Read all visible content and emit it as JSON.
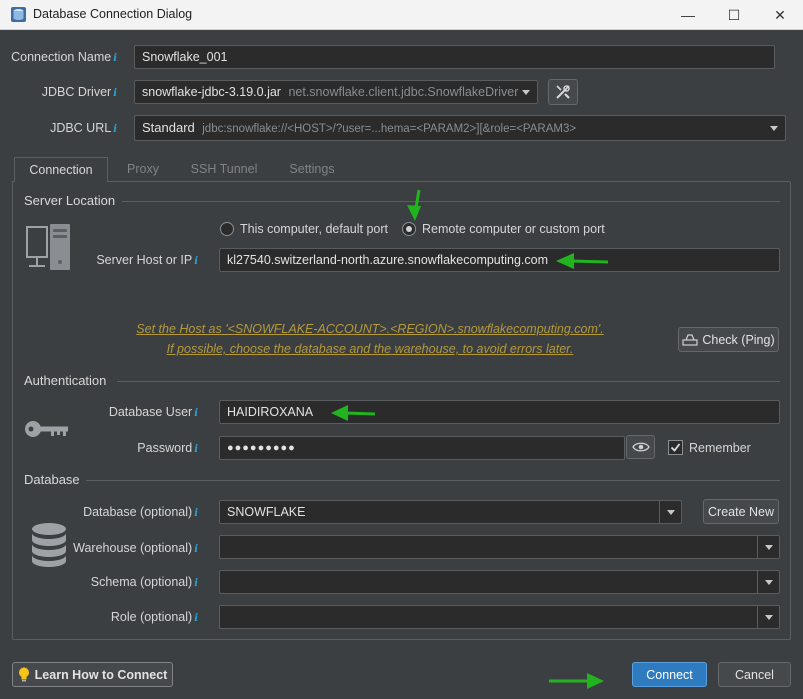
{
  "window": {
    "title": "Database Connection Dialog",
    "minimize": "—",
    "maximize": "☐",
    "close": "✕"
  },
  "form": {
    "connection_name_label": "Connection Name",
    "connection_name_value": "Snowflake_001",
    "jdbc_driver_label": "JDBC Driver",
    "jdbc_driver_jar": "snowflake-jdbc-3.19.0.jar",
    "jdbc_driver_class": "net.snowflake.client.jdbc.SnowflakeDriver",
    "jdbc_url_label": "JDBC URL",
    "jdbc_url_mode": "Standard",
    "jdbc_url_template": "jdbc:snowflake://<HOST>/?user=...hema=<PARAM2>][&role=<PARAM3>"
  },
  "tabs": [
    {
      "label": "Connection",
      "active": true
    },
    {
      "label": "Proxy",
      "active": false
    },
    {
      "label": "SSH Tunnel",
      "active": false
    },
    {
      "label": "Settings",
      "active": false
    }
  ],
  "server": {
    "section_label": "Server Location",
    "radio_local_label": "This computer, default port",
    "radio_remote_label": "Remote computer or custom port",
    "selected": "remote",
    "host_label": "Server Host or IP",
    "host_value": "kl27540.switzerland-north.azure.snowflakecomputing.com",
    "hint_line1": "Set the Host as '<SNOWFLAKE-ACCOUNT>.<REGION>.snowflakecomputing.com'.",
    "hint_line2": "If possible, choose the database and the warehouse, to avoid errors later.",
    "ping_button": "Check (Ping)"
  },
  "auth": {
    "section_label": "Authentication",
    "user_label": "Database User",
    "user_value": "HAIDIROXANA",
    "password_label": "Password",
    "password_value": "●●●●●●●●●",
    "remember_label": "Remember",
    "remember_checked": true
  },
  "database": {
    "section_label": "Database",
    "database_label": "Database (optional)",
    "database_value": "SNOWFLAKE",
    "create_new_button": "Create New",
    "warehouse_label": "Warehouse (optional)",
    "warehouse_value": "",
    "schema_label": "Schema (optional)",
    "schema_value": "",
    "role_label": "Role (optional)",
    "role_value": ""
  },
  "footer": {
    "learn_button": "Learn How to Connect",
    "connect_button": "Connect",
    "cancel_button": "Cancel"
  },
  "colors": {
    "background": "#3c3f41",
    "field": "#2b2b2b",
    "accent": "#2f7bbf",
    "info_icon": "#2aa1d6",
    "hint": "#b59a3a",
    "annotation_arrow": "#22b41e"
  }
}
